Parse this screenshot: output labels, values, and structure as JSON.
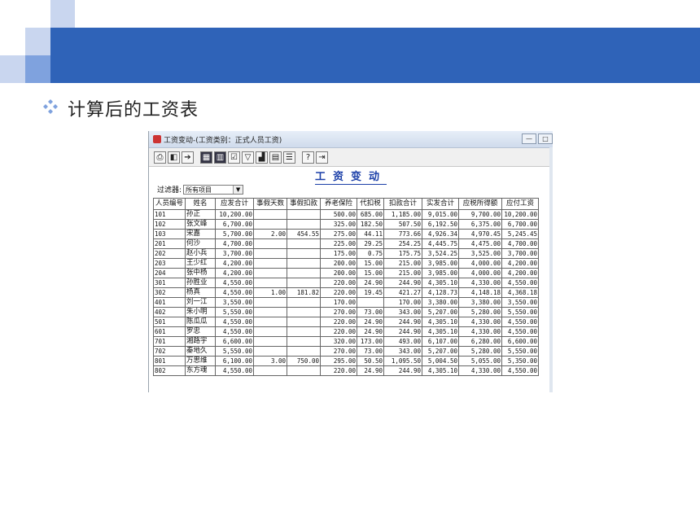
{
  "slide": {
    "title": "计算后的工资表",
    "colors": {
      "header_band": "#2f63b8",
      "accent_light": "#c9d6ef",
      "accent_mid": "#7fa2de",
      "report_title": "#1b3fa8"
    }
  },
  "window": {
    "title": "工资变动-(工资类别：正式人员工资)",
    "toolbar_icons": [
      "print-icon",
      "preview-icon",
      "export-icon",
      "grid-icon",
      "filter-grid-icon",
      "settings-icon",
      "filter-icon",
      "chart-icon",
      "list-icon",
      "columns-icon",
      "help-icon",
      "exit-icon"
    ]
  },
  "report": {
    "title": "工资变动",
    "filter_label": "过滤器:",
    "filter_value": "所有项目"
  },
  "table": {
    "headers": [
      "人员编号",
      "姓名",
      "应发合计",
      "事假天数",
      "事假扣款",
      "养老保险",
      "代扣税",
      "扣款合计",
      "实发合计",
      "应税所得额",
      "应付工资"
    ],
    "rows": [
      [
        "101",
        "孙正",
        "10,200.00",
        "",
        "",
        "500.00",
        "685.00",
        "1,185.00",
        "9,015.00",
        "9,700.00",
        "10,200.00"
      ],
      [
        "102",
        "张文峰",
        "6,700.00",
        "",
        "",
        "325.00",
        "182.50",
        "507.50",
        "6,192.50",
        "6,375.00",
        "6,700.00"
      ],
      [
        "103",
        "宋嘉",
        "5,700.00",
        "2.00",
        "454.55",
        "275.00",
        "44.11",
        "773.66",
        "4,926.34",
        "4,970.45",
        "5,245.45"
      ],
      [
        "201",
        "何沙",
        "4,700.00",
        "",
        "",
        "225.00",
        "29.25",
        "254.25",
        "4,445.75",
        "4,475.00",
        "4,700.00"
      ],
      [
        "202",
        "赵小兵",
        "3,700.00",
        "",
        "",
        "175.00",
        "0.75",
        "175.75",
        "3,524.25",
        "3,525.00",
        "3,700.00"
      ],
      [
        "203",
        "王少红",
        "4,200.00",
        "",
        "",
        "200.00",
        "15.00",
        "215.00",
        "3,985.00",
        "4,000.00",
        "4,200.00"
      ],
      [
        "204",
        "张中杨",
        "4,200.00",
        "",
        "",
        "200.00",
        "15.00",
        "215.00",
        "3,985.00",
        "4,000.00",
        "4,200.00"
      ],
      [
        "301",
        "孙胜业",
        "4,550.00",
        "",
        "",
        "220.00",
        "24.90",
        "244.90",
        "4,305.10",
        "4,330.00",
        "4,550.00"
      ],
      [
        "302",
        "杨真",
        "4,550.00",
        "1.00",
        "181.82",
        "220.00",
        "19.45",
        "421.27",
        "4,128.73",
        "4,148.18",
        "4,368.18"
      ],
      [
        "401",
        "刘一江",
        "3,550.00",
        "",
        "",
        "170.00",
        "",
        "170.00",
        "3,380.00",
        "3,380.00",
        "3,550.00"
      ],
      [
        "402",
        "朱小明",
        "5,550.00",
        "",
        "",
        "270.00",
        "73.00",
        "343.00",
        "5,207.00",
        "5,280.00",
        "5,550.00"
      ],
      [
        "501",
        "陈瓜瓜",
        "4,550.00",
        "",
        "",
        "220.00",
        "24.90",
        "244.90",
        "4,305.10",
        "4,330.00",
        "4,550.00"
      ],
      [
        "601",
        "罗忠",
        "4,550.00",
        "",
        "",
        "220.00",
        "24.90",
        "244.90",
        "4,305.10",
        "4,330.00",
        "4,550.00"
      ],
      [
        "701",
        "湘路宇",
        "6,600.00",
        "",
        "",
        "320.00",
        "173.00",
        "493.00",
        "6,107.00",
        "6,280.00",
        "6,600.00"
      ],
      [
        "702",
        "秦地久",
        "5,550.00",
        "",
        "",
        "270.00",
        "73.00",
        "343.00",
        "5,207.00",
        "5,280.00",
        "5,550.00"
      ],
      [
        "801",
        "万思维",
        "6,100.00",
        "3.00",
        "750.00",
        "295.00",
        "50.50",
        "1,095.50",
        "5,004.50",
        "5,055.00",
        "5,350.00"
      ],
      [
        "802",
        "东方魂",
        "4,550.00",
        "",
        "",
        "220.00",
        "24.90",
        "244.90",
        "4,305.10",
        "4,330.00",
        "4,550.00"
      ]
    ]
  }
}
